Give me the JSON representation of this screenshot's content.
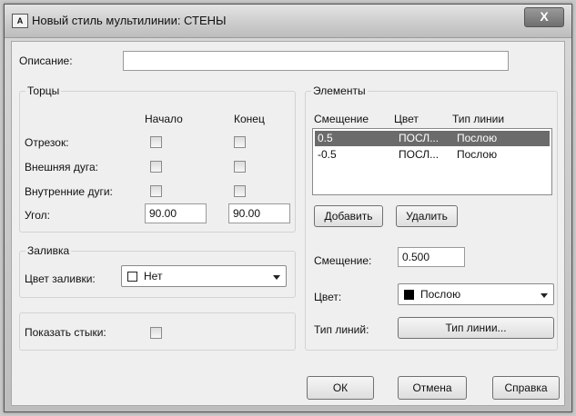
{
  "window": {
    "icon_text": "A",
    "title": "Новый стиль мультилинии: СТЕНЫ",
    "close_glyph": "X"
  },
  "description": {
    "label": "Описание:",
    "value": ""
  },
  "caps": {
    "title": "Торцы",
    "col_start": "Начало",
    "col_end": "Конец",
    "rows": [
      {
        "label": "Отрезок:",
        "start_checked": false,
        "end_checked": false
      },
      {
        "label": "Внешняя дуга:",
        "start_checked": false,
        "end_checked": false
      },
      {
        "label": "Внутренние дуги:",
        "start_checked": false,
        "end_checked": false
      }
    ],
    "angle_label": "Угол:",
    "angle_start": "90.00",
    "angle_end": "90.00"
  },
  "fill": {
    "title": "Заливка",
    "color_label": "Цвет заливки:",
    "color_value": "Нет",
    "swatch_color": "#ffffff"
  },
  "joints": {
    "label": "Показать стыки:",
    "checked": false
  },
  "elements": {
    "title": "Элементы",
    "headers": [
      "Смещение",
      "Цвет",
      "Тип линии"
    ],
    "rows": [
      {
        "offset": "0.5",
        "color": "ПОСЛ...",
        "linetype": "Послою",
        "selected": true
      },
      {
        "offset": "-0.5",
        "color": "ПОСЛ...",
        "linetype": "Послою",
        "selected": false
      }
    ],
    "add_label": "Добавить",
    "delete_label": "Удалить",
    "offset_label": "Смещение:",
    "offset_value": "0.500",
    "color_label": "Цвет:",
    "color_value": "Послою",
    "color_swatch": "#000000",
    "linetype_label": "Тип линий:",
    "linetype_button": "Тип линии..."
  },
  "footer": {
    "ok_label": "ОК",
    "cancel_label": "Отмена",
    "help_label": "Справка"
  }
}
